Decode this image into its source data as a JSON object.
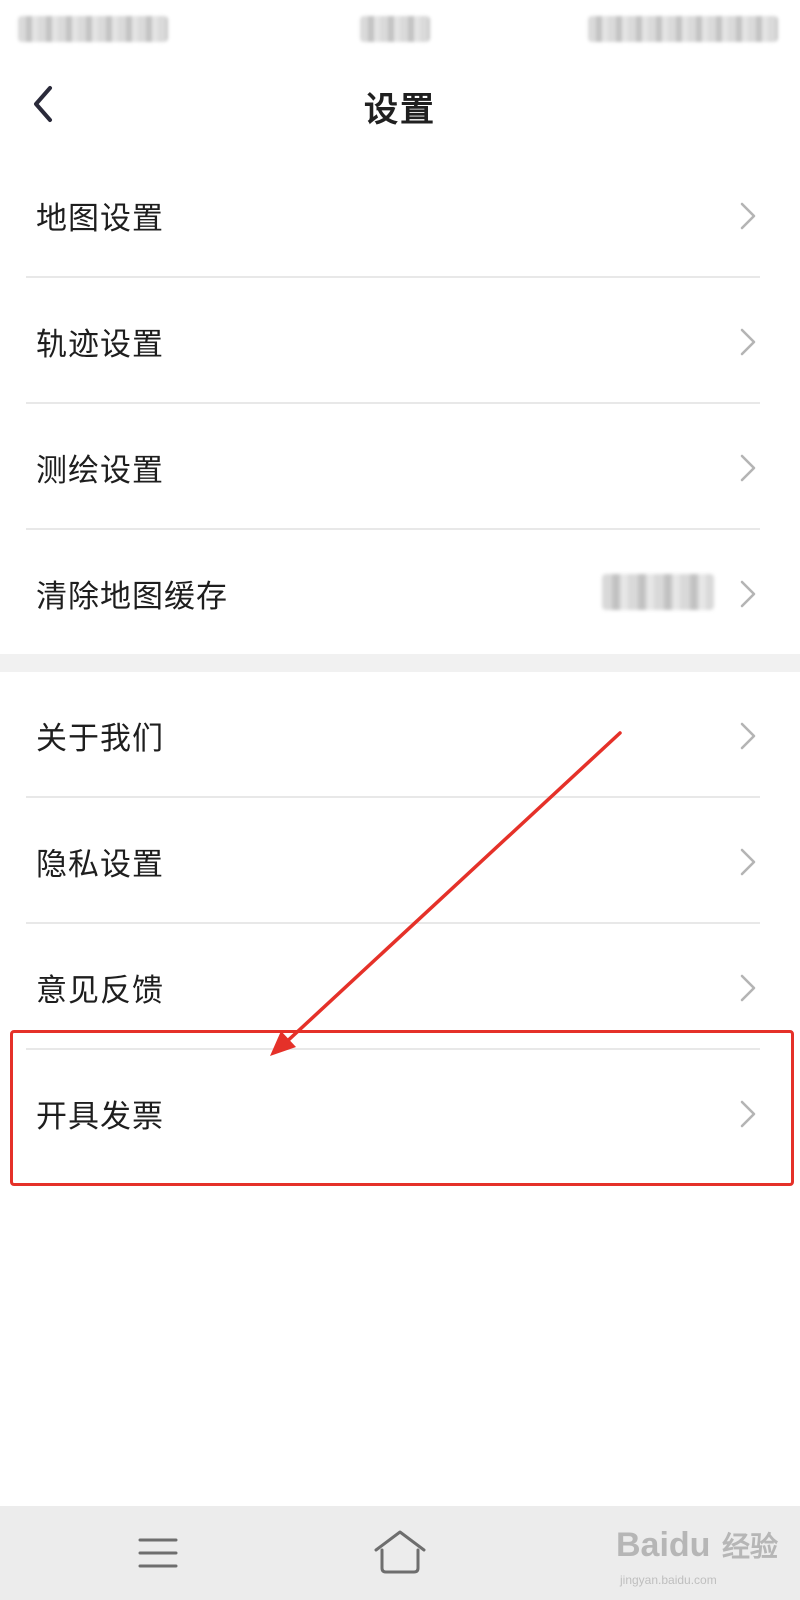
{
  "header": {
    "title": "设置"
  },
  "settings": {
    "group1": [
      {
        "label": "地图设置"
      },
      {
        "label": "轨迹设置"
      },
      {
        "label": "测绘设置"
      },
      {
        "label": "清除地图缓存"
      }
    ],
    "group2": [
      {
        "label": "关于我们"
      },
      {
        "label": "隐私设置"
      },
      {
        "label": "意见反馈"
      },
      {
        "label": "开具发票"
      }
    ]
  },
  "annotation": {
    "color": "#e53129"
  },
  "watermark": {
    "brand": "Baidu",
    "brand_suffix": "经验",
    "url": "jingyan.baidu.com"
  }
}
